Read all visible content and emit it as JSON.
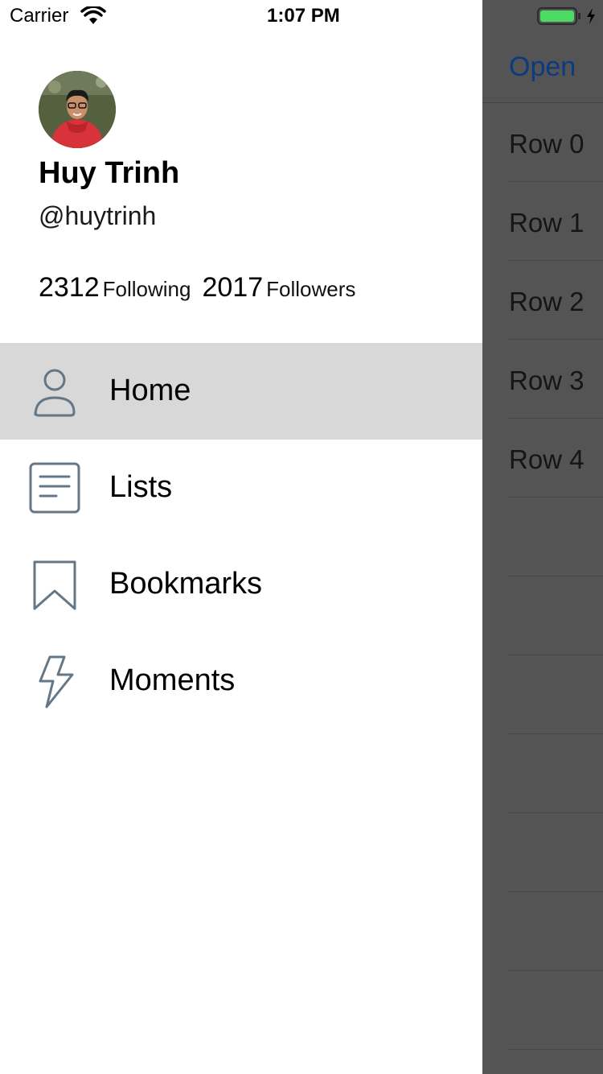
{
  "status_bar": {
    "carrier": "Carrier",
    "time": "1:07 PM",
    "battery_color": "#4cd964"
  },
  "profile": {
    "name": "Huy Trinh",
    "handle": "@huytrinh",
    "following_count": "2312",
    "following_label": "Following",
    "followers_count": "2017",
    "followers_label": "Followers"
  },
  "menu": {
    "items": [
      {
        "label": "Home",
        "icon": "person-icon",
        "selected": true
      },
      {
        "label": "Lists",
        "icon": "list-icon",
        "selected": false
      },
      {
        "label": "Bookmarks",
        "icon": "bookmark-icon",
        "selected": false
      },
      {
        "label": "Moments",
        "icon": "lightning-icon",
        "selected": false
      }
    ]
  },
  "background_screen": {
    "nav_button": "Open",
    "rows": [
      "Row 0",
      "Row 1",
      "Row 2",
      "Row 3",
      "Row 4",
      "",
      "",
      "",
      "",
      "",
      "",
      ""
    ]
  },
  "colors": {
    "icon_stroke": "#657786",
    "selected_row": "#d8d8d8",
    "dim_overlay": "#545454",
    "link_blue": "#0a3a82"
  }
}
